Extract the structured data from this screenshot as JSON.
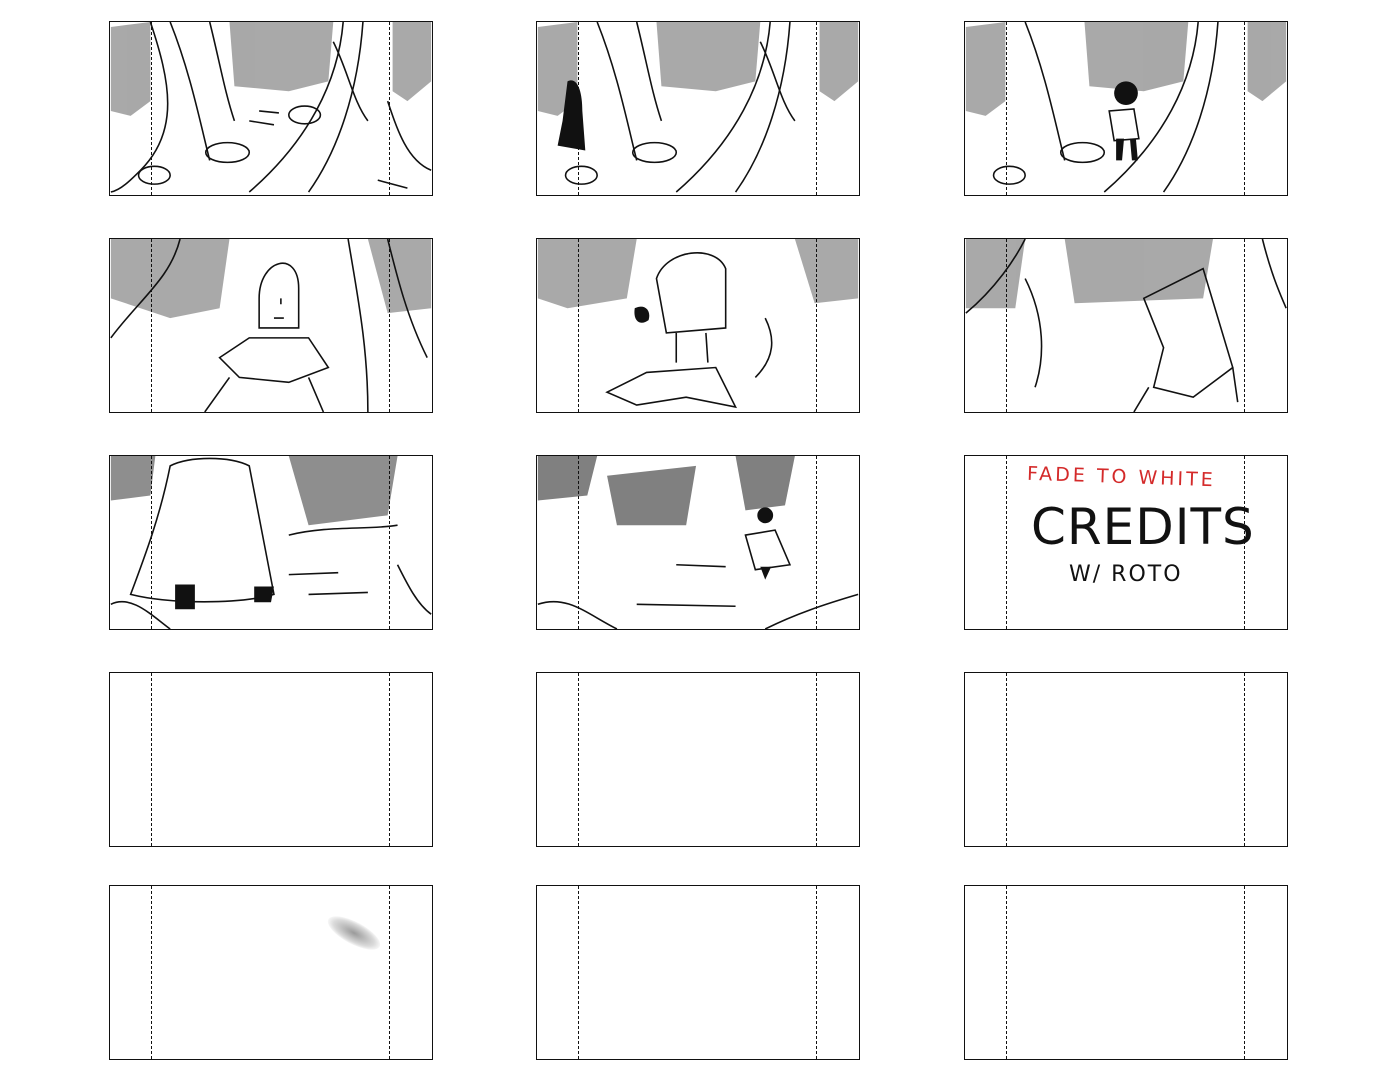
{
  "storyboard": {
    "layout": "5 rows x 3 columns",
    "panels": [
      {
        "id": "p1",
        "content": "forest-trees"
      },
      {
        "id": "p2",
        "content": "forest-trees-cloaked-figure"
      },
      {
        "id": "p3",
        "content": "forest-trees-girl-walking"
      },
      {
        "id": "p4",
        "content": "girl-closeup-front"
      },
      {
        "id": "p5",
        "content": "girl-closeup-profile"
      },
      {
        "id": "p6",
        "content": "cloak-back-view"
      },
      {
        "id": "p7",
        "content": "cloak-walking-away"
      },
      {
        "id": "p8",
        "content": "path-figure-distance"
      },
      {
        "id": "p9",
        "content": "text-notes"
      },
      {
        "id": "p10",
        "content": "blank"
      },
      {
        "id": "p11",
        "content": "blank"
      },
      {
        "id": "p12",
        "content": "blank"
      },
      {
        "id": "p13",
        "content": "blank-smudge"
      },
      {
        "id": "p14",
        "content": "blank"
      },
      {
        "id": "p15",
        "content": "blank"
      }
    ],
    "notes": {
      "fade": "FADE TO WHITE",
      "credits": "CREDITS",
      "roto": "W/ ROTO"
    },
    "colors": {
      "line": "#111111",
      "shading": "#8a8a8a",
      "note_red": "#d42a2a"
    }
  }
}
